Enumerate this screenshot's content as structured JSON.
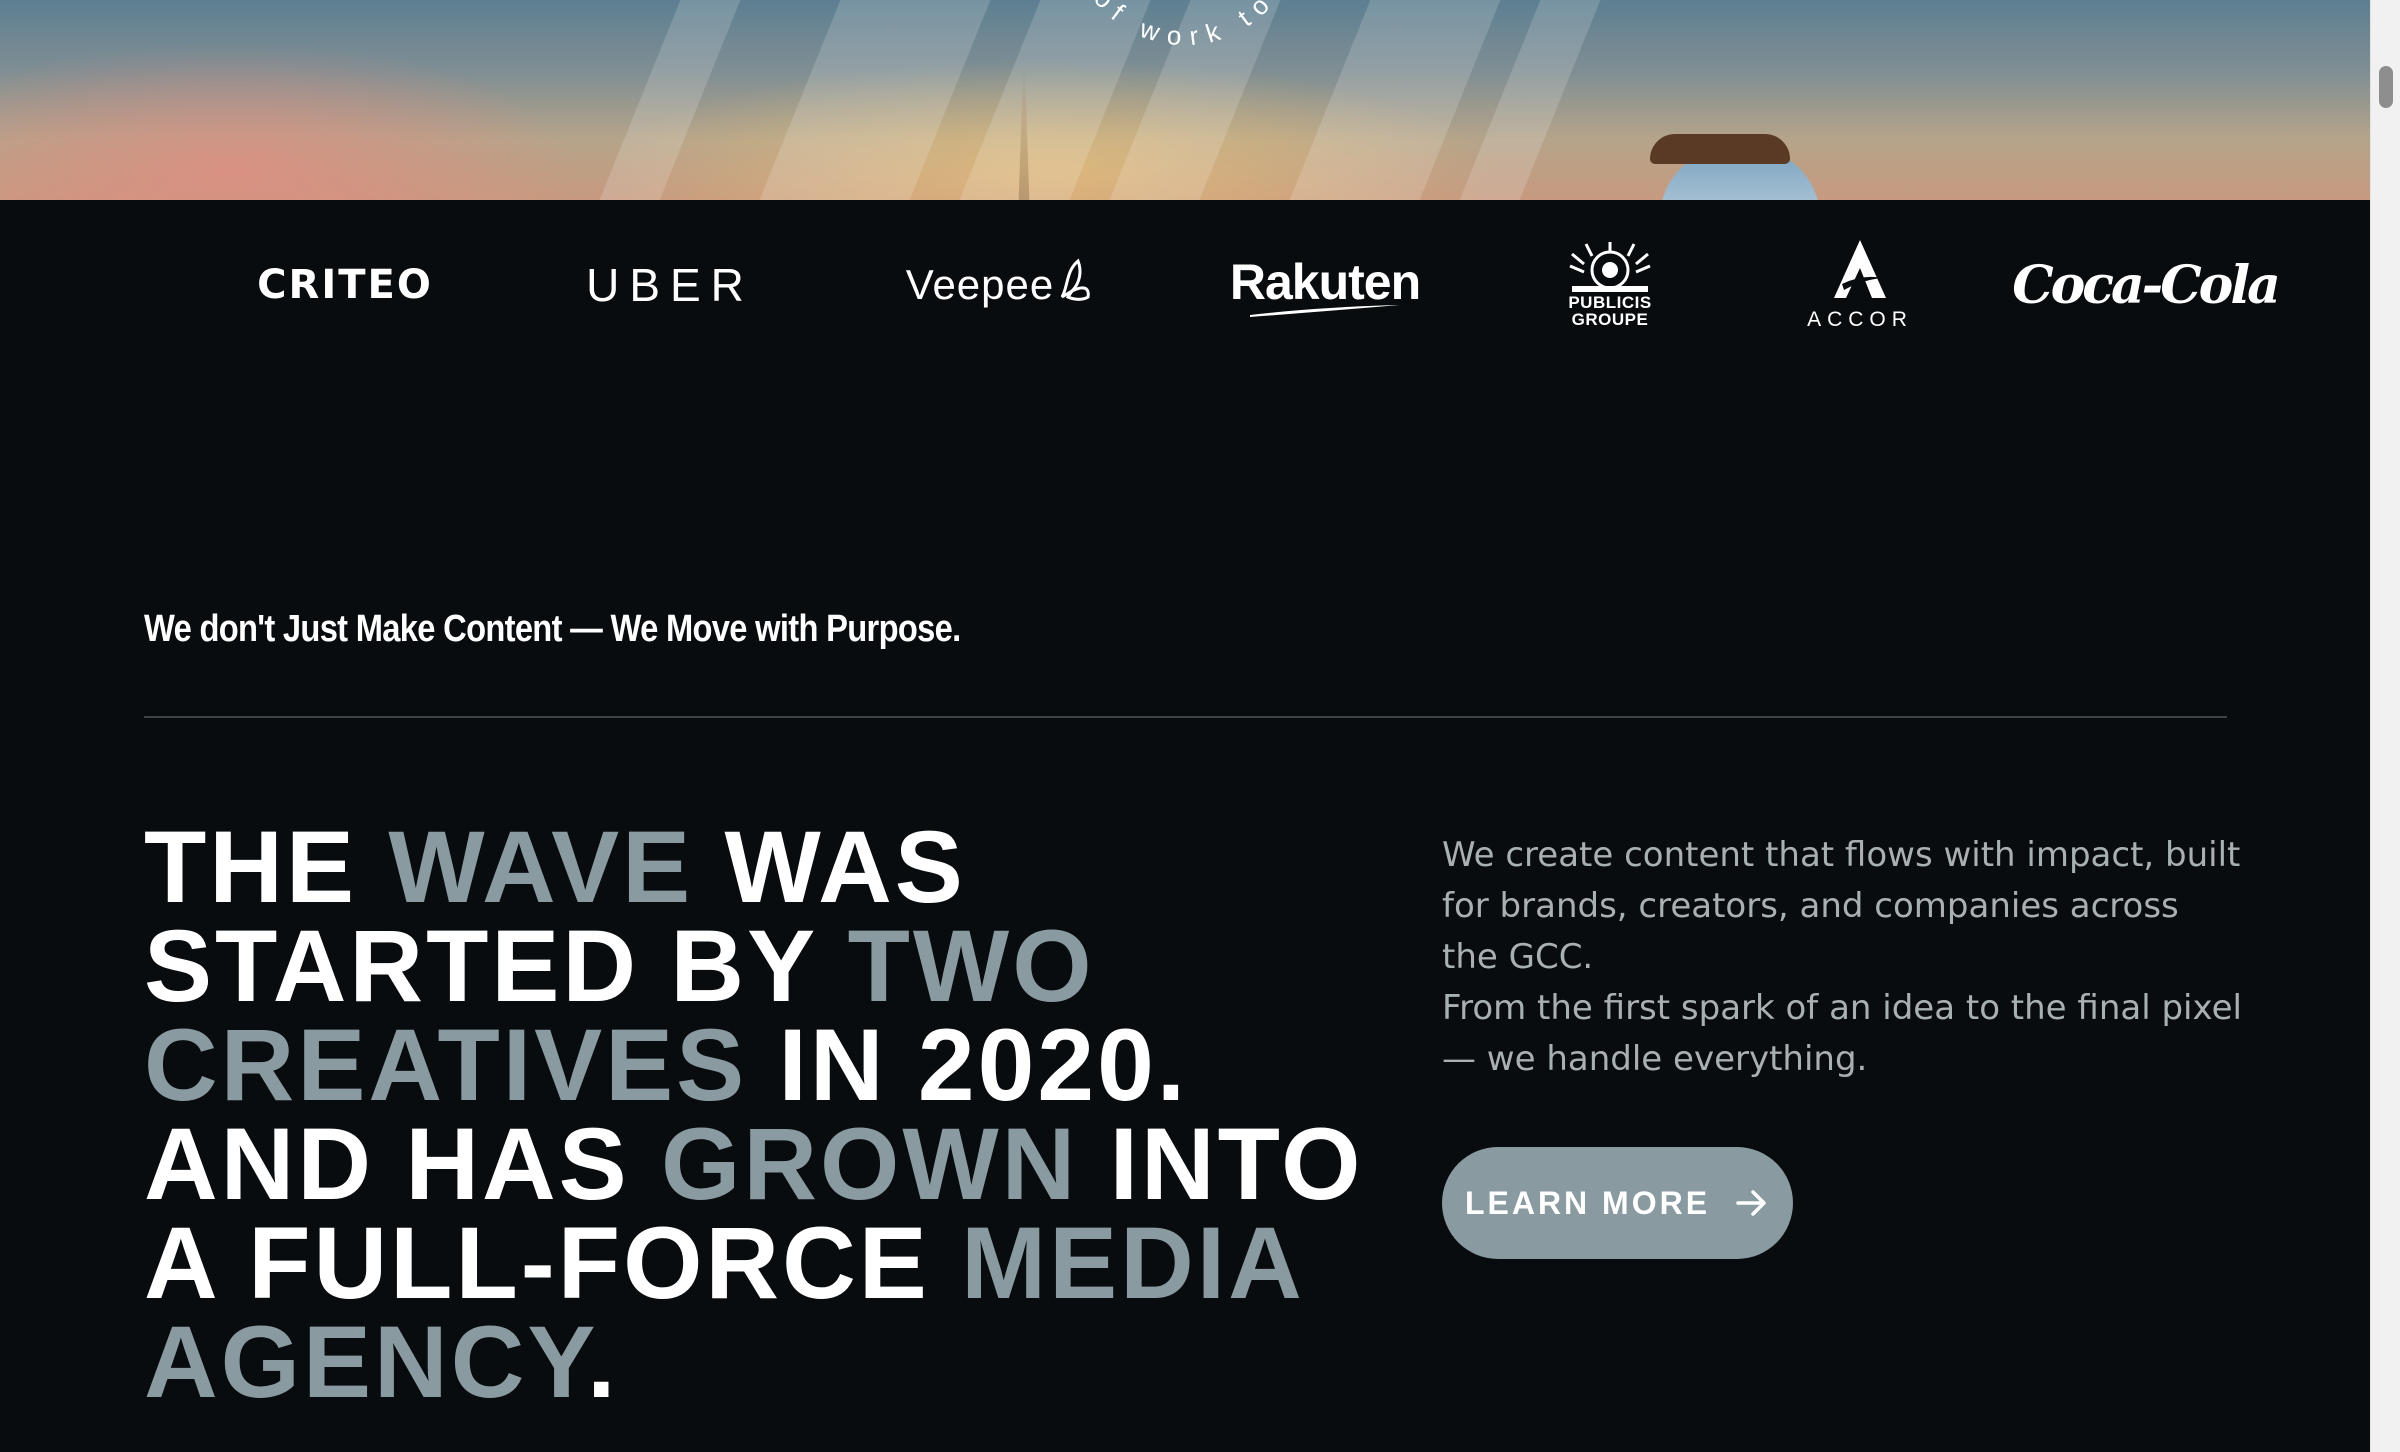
{
  "hero": {
    "circle_text": "of work to"
  },
  "logos": [
    {
      "name": "criteo",
      "label": "CRITEO"
    },
    {
      "name": "uber",
      "label": "UBER"
    },
    {
      "name": "veepee",
      "label": "Veepee"
    },
    {
      "name": "rakuten",
      "label": "Rakuten"
    },
    {
      "name": "publicis",
      "label_line1": "PUBLICIS",
      "label_line2": "GROUPE"
    },
    {
      "name": "accor",
      "label": "ACCOR"
    },
    {
      "name": "coca-cola",
      "label": "Coca-Cola"
    }
  ],
  "tagline": "We don't Just Make Content — We Move with Purpose.",
  "headline": {
    "line1": {
      "a": "The ",
      "b": "wave",
      "c": " was"
    },
    "line2": {
      "a": "started by ",
      "b": "two"
    },
    "line3": {
      "a": "creatives",
      "b": " in 2020."
    },
    "line4": {
      "a": "And has ",
      "b": "grown",
      "c": " into"
    },
    "line5": {
      "a": "a full-force ",
      "b": "media"
    },
    "line6": {
      "a": "agency",
      "b": "."
    }
  },
  "description": {
    "para1": "We create content that flows with impact, built for brands, creators, and companies across the GCC.",
    "para2": "From the first spark of an idea to the final pixel — we handle everything."
  },
  "cta": {
    "label": "Learn More",
    "icon": "arrow-right-icon"
  },
  "colors": {
    "background": "#080c0e",
    "text_white": "#ffffff",
    "accent_grey": "#8a9aa1",
    "body_text": "#a9b0b3"
  }
}
